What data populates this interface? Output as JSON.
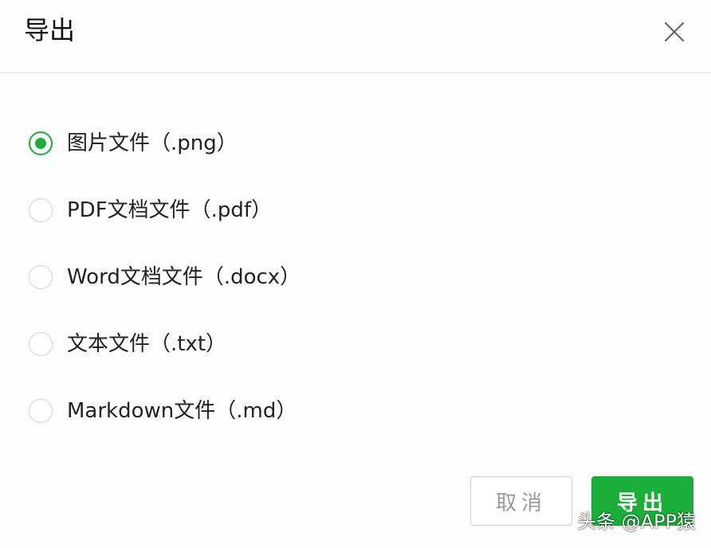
{
  "dialog": {
    "title": "导出",
    "close_icon": "close-icon"
  },
  "options": [
    {
      "label": "图片文件（.png）",
      "checked": true
    },
    {
      "label": "PDF文档文件（.pdf）",
      "checked": false
    },
    {
      "label": "Word文档文件（.docx）",
      "checked": false
    },
    {
      "label": "文本文件（.txt）",
      "checked": false
    },
    {
      "label": "Markdown文件（.md）",
      "checked": false
    }
  ],
  "footer": {
    "cancel_label": "取消",
    "export_label": "导出"
  },
  "watermark": "头条 @APP猿",
  "colors": {
    "accent": "#1aad3a",
    "border": "#d3d3d6",
    "text": "#222222"
  }
}
